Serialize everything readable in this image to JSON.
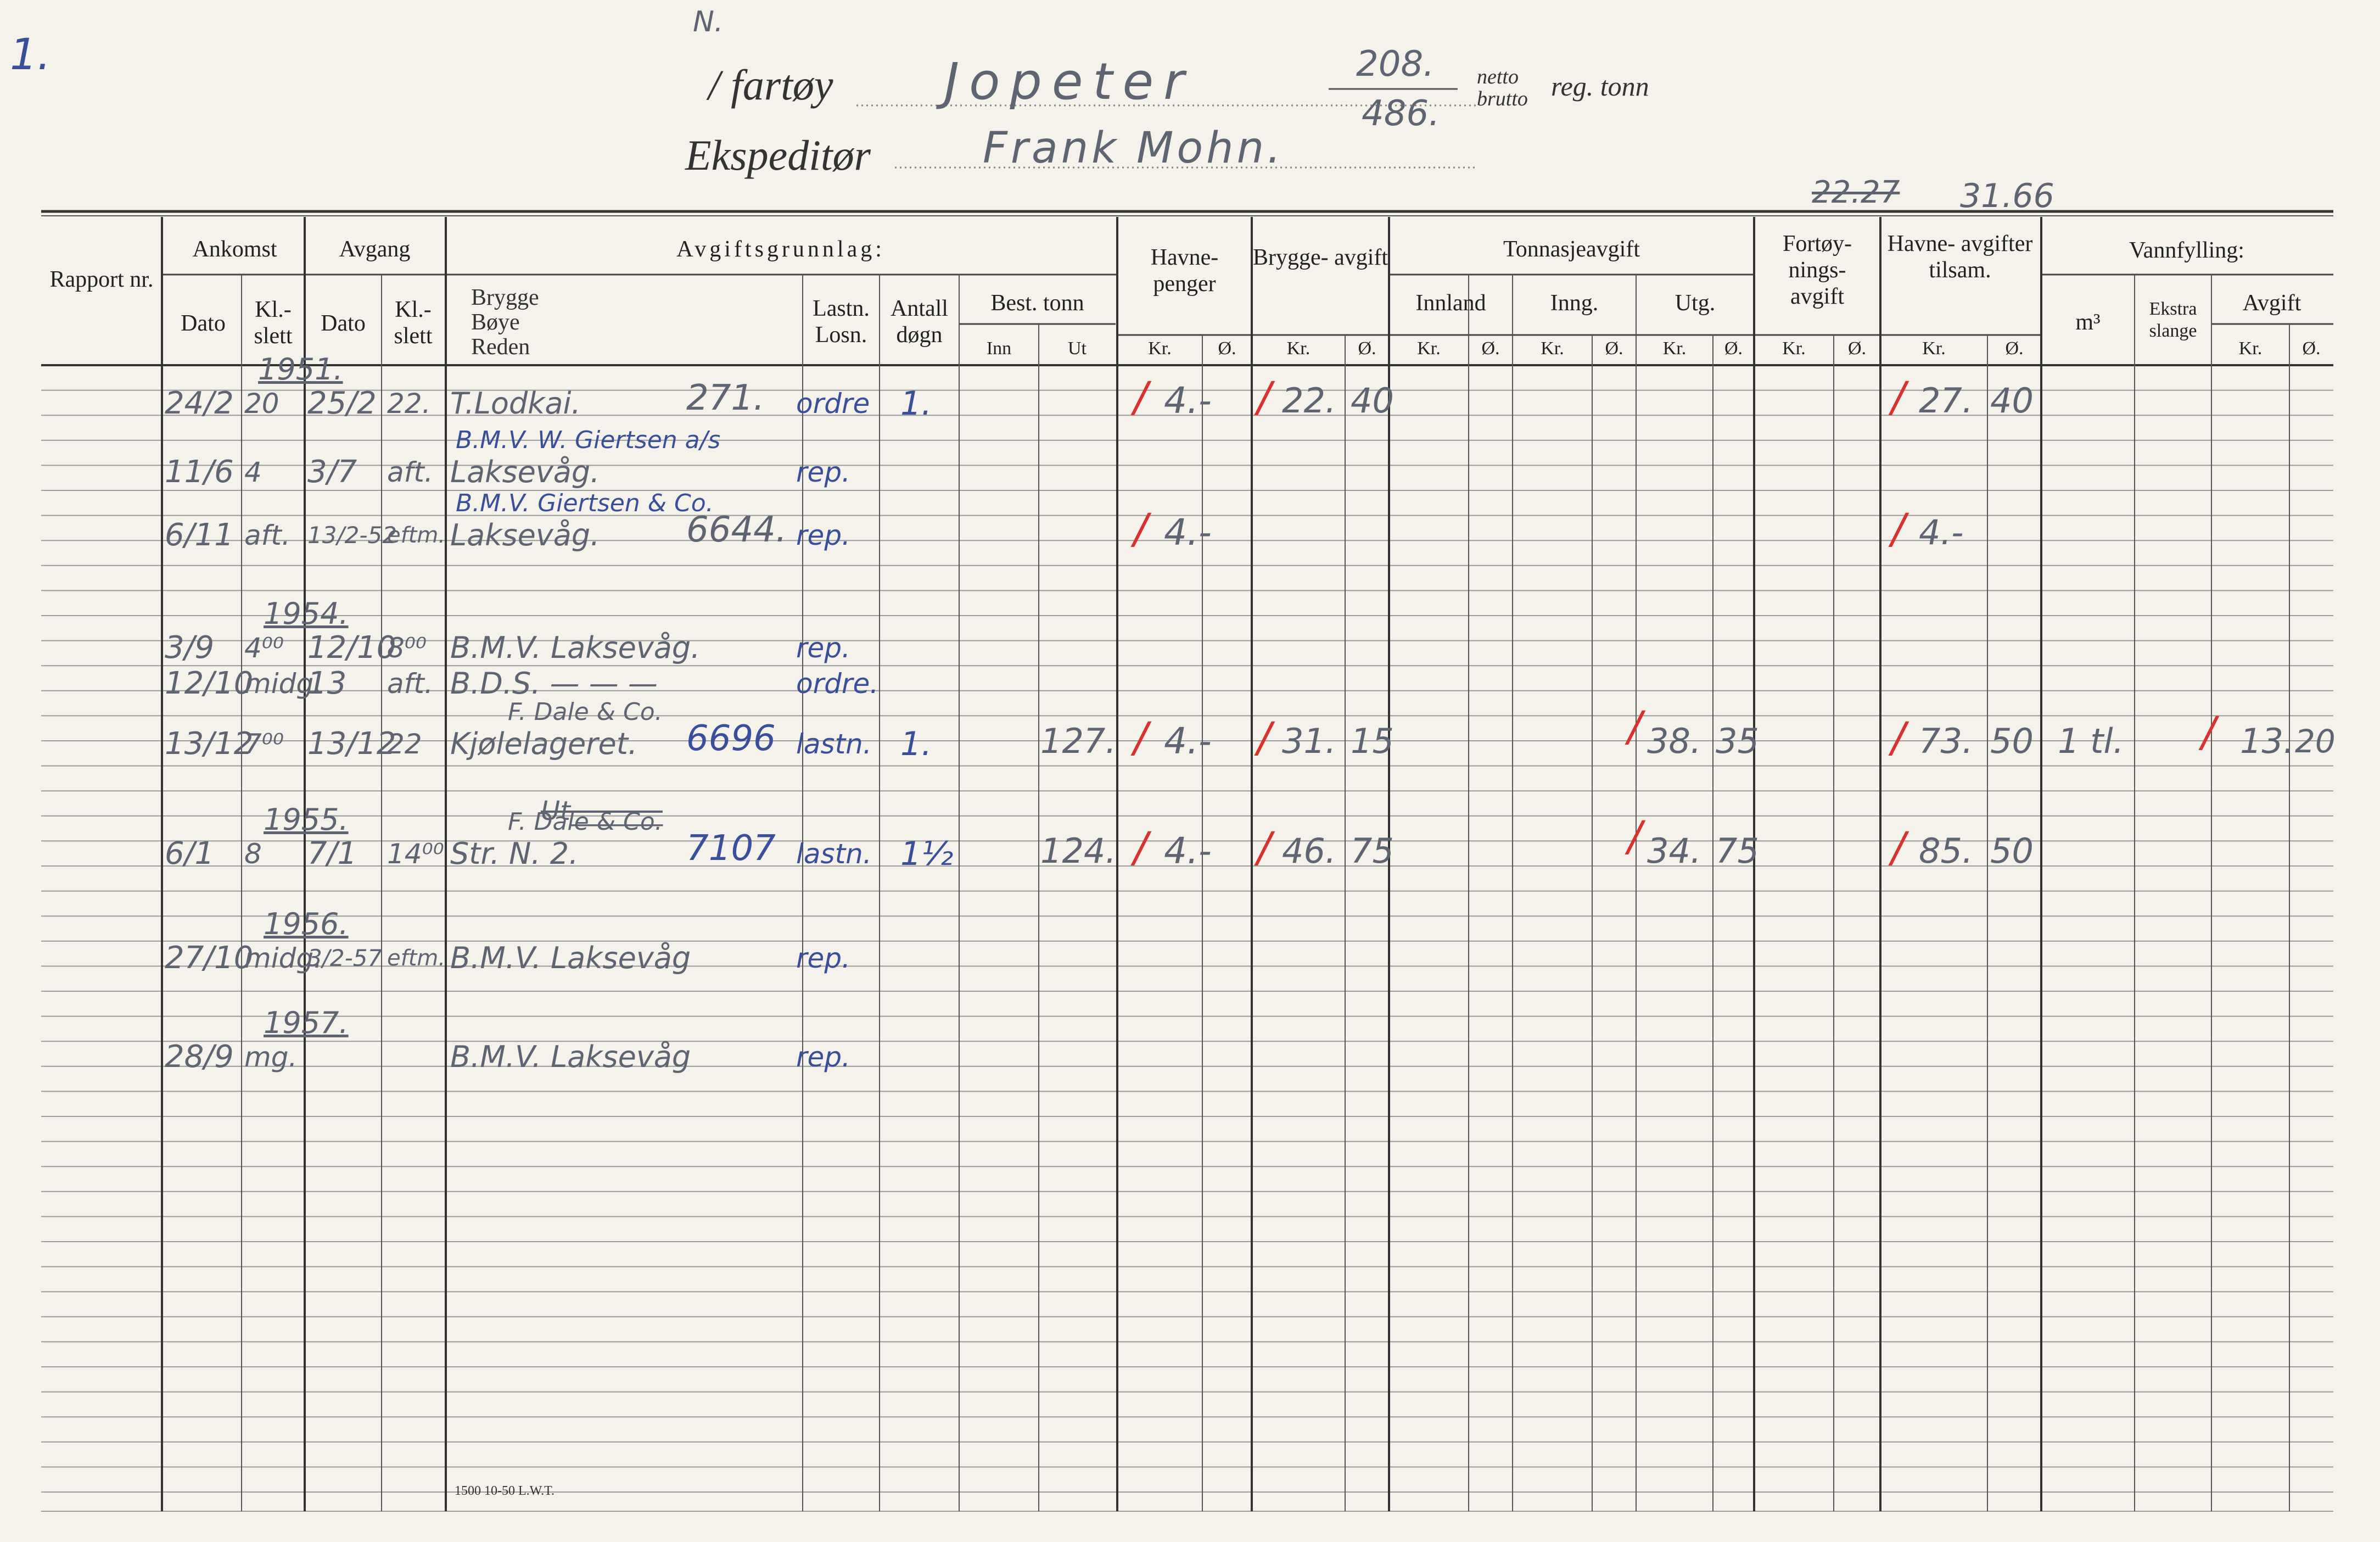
{
  "corner_mark": "1.",
  "top_mark": "N.",
  "vessel": {
    "label": "/ fartøy",
    "name": "Jopeter",
    "netto": "208.",
    "brutto": "486.",
    "netto_label": "netto",
    "brutto_label": "brutto",
    "unit_label": "reg. tonn"
  },
  "agent": {
    "label": "Ekspeditør",
    "name": "Frank Mohn."
  },
  "top_right_struck": "22.27",
  "top_right_value": "31.66",
  "headers": {
    "rapport": "Rapport nr.",
    "ankomst": "Ankomst",
    "avgang": "Avgang",
    "dato": "Dato",
    "klslett": "Kl.- slett",
    "avgiftsgrunnlag": "Avgiftsgrunnlag:",
    "brygge": "Brygge",
    "boye": "Bøye",
    "reden": "Reden",
    "lastn": "Lastn. Losn.",
    "antall": "Antall døgn",
    "best_tonn": "Best. tonn",
    "inn": "Inn",
    "ut": "Ut",
    "havnepenger": "Havne- penger",
    "bryggeavgift": "Brygge- avgift",
    "tonnasjeavgift": "Tonnasjeavgift",
    "innland": "Innland",
    "inng": "Inng.",
    "utg": "Utg.",
    "fortoyning": "Fortøy- nings- avgift",
    "havneavgifter": "Havne- avgifter tilsam.",
    "vannfylling": "Vannfylling:",
    "m3": "m³",
    "ekstra": "Ekstra slange",
    "avgift": "Avgift",
    "kr": "Kr.",
    "o": "Ø."
  },
  "footer_print": "1500 10-50 L.W.T.",
  "rows": [
    {
      "year": "1951.",
      "ank_dato": "24/2",
      "ank_kl": "20",
      "avg_dato": "25/2",
      "avg_kl": "22.",
      "sted": "T.Lodkai.",
      "sted_nr": "271.",
      "lastn": "ordre",
      "antall": "1.",
      "havn_kr": "4.-",
      "brygge_kr": "22.",
      "brygge_o": "40",
      "sum_kr": "27.",
      "sum_o": "40"
    },
    {
      "ank_dato": "11/6",
      "ank_kl": "4",
      "avg_dato": "3/7",
      "avg_kl": "aft.",
      "sted_above": "B.M.V.  W. Giertsen a/s",
      "sted": "Laksevåg.",
      "lastn": "rep."
    },
    {
      "ank_dato": "6/11",
      "ank_kl": "aft.",
      "avg_dato": "13/2-52",
      "avg_kl": "eftm.",
      "sted_above": "B.M.V.  Giertsen & Co.",
      "sted": "Laksevåg.",
      "sted_nr": "6644.",
      "lastn": "rep.",
      "havn_kr": "4.-",
      "sum_kr": "4.-"
    },
    {
      "year": "1954.",
      "ank_dato": "3/9",
      "ank_kl": "4⁰⁰",
      "avg_dato": "12/10",
      "avg_kl": "8⁰⁰",
      "sted": "B.M.V. Laksevåg.",
      "lastn": "rep."
    },
    {
      "ank_dato": "12/10",
      "ank_kl": "midg.",
      "avg_dato": "13",
      "avg_kl": "aft.",
      "sted": "B.D.S. — — —",
      "lastn": "ordre."
    },
    {
      "ank_dato": "13/12",
      "ank_kl": "7⁰⁰",
      "avg_dato": "13/12",
      "avg_kl": "22",
      "sted_above": "F. Dale & Co.",
      "sted": "Kjølelageret.",
      "sted_nr": "6696",
      "lastn": "lastn.",
      "antall": "1.",
      "ut": "127.",
      "havn_kr": "4.-",
      "brygge_kr": "31.",
      "brygge_o": "15",
      "utg_kr": "38.",
      "utg_o": "35",
      "sum_kr": "73.",
      "sum_o": "50",
      "m3": "1 tl.",
      "vann_kr": "13.",
      "vann_o": "20"
    },
    {
      "year": "1955.",
      "ank_dato": "6/1",
      "ank_kl": "8",
      "avg_dato": "7/1",
      "avg_kl": "14⁰⁰",
      "sted_struck": "Ut_______",
      "sted_above": "F. Dale & Co.",
      "sted": "Str. N. 2.",
      "sted_nr": "7107",
      "lastn": "lastn.",
      "antall": "1½",
      "ut": "124.",
      "havn_kr": "4.-",
      "brygge_kr": "46.",
      "brygge_o": "75",
      "utg_kr": "34.",
      "utg_o": "75",
      "sum_kr": "85.",
      "sum_o": "50"
    },
    {
      "year": "1956.",
      "ank_dato": "27/10",
      "ank_kl": "midg.",
      "avg_dato": "3/2-57",
      "avg_kl": "eftm.",
      "sted": "B.M.V. Laksevåg",
      "lastn": "rep."
    },
    {
      "year": "1957.",
      "ank_dato": "28/9",
      "ank_kl": "mg.",
      "sted": "B.M.V. Laksevåg",
      "lastn": "rep."
    }
  ]
}
